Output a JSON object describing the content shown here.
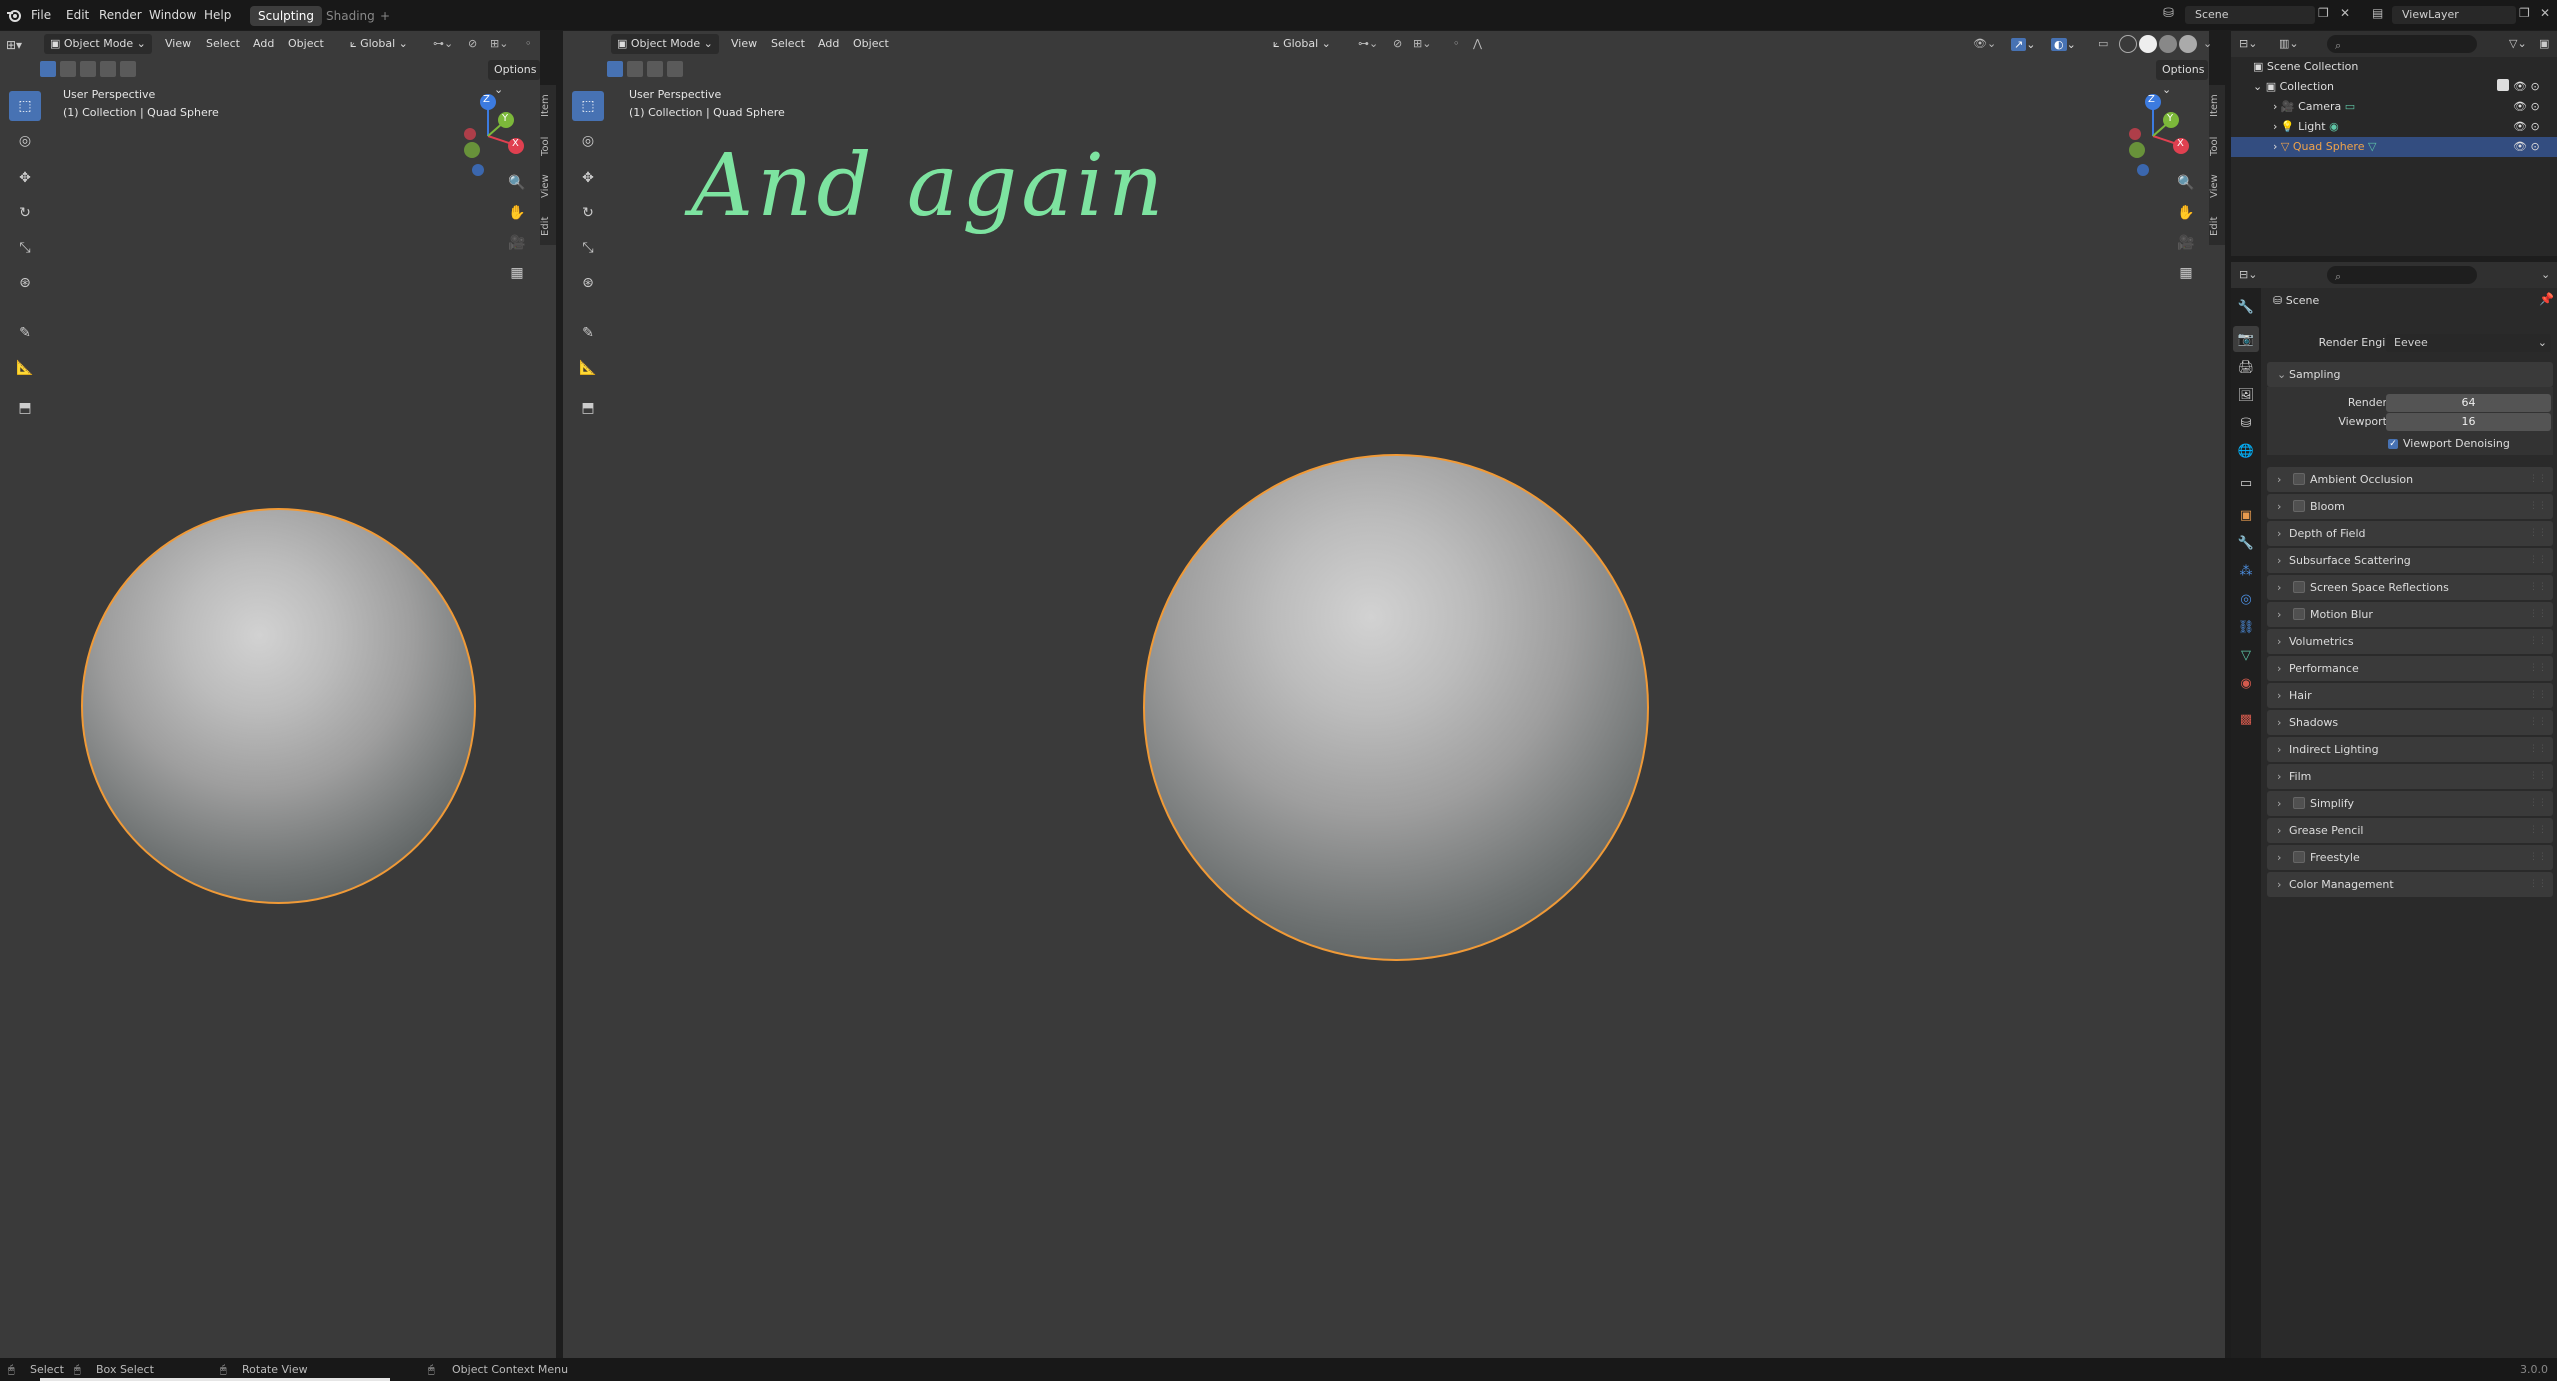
{
  "topbar": {
    "menus": [
      "File",
      "Edit",
      "Render",
      "Window",
      "Help"
    ],
    "workspaces": [
      "Sculpting",
      "Shading"
    ],
    "add_tab": "+",
    "scene_label": "Scene",
    "viewlayer_label": "ViewLayer"
  },
  "left_viewport": {
    "mode": "Object Mode",
    "menus": [
      "View",
      "Select",
      "Add",
      "Object"
    ],
    "orientation": "Global",
    "options": "Options",
    "perspective": "User Perspective",
    "collection": "(1) Collection | Quad Sphere",
    "side_tabs": [
      "Item",
      "Tool",
      "View",
      "Edit"
    ]
  },
  "right_viewport": {
    "mode": "Object Mode",
    "menus": [
      "View",
      "Select",
      "Add",
      "Object"
    ],
    "orientation": "Global",
    "options": "Options",
    "perspective": "User Perspective",
    "collection": "(1) Collection | Quad Sphere",
    "annotation": "And again",
    "side_tabs": [
      "Item",
      "Tool",
      "View",
      "Edit"
    ]
  },
  "gizmo": {
    "x": "X",
    "y": "Y",
    "z": "Z"
  },
  "outliner": {
    "root": "Scene Collection",
    "collection": "Collection",
    "items": [
      "Camera",
      "Light",
      "Quad Sphere"
    ]
  },
  "properties": {
    "context": "Scene",
    "render_engine_label": "Render Engine",
    "render_engine_value": "Eevee",
    "sampling": "Sampling",
    "render_label": "Render",
    "render_value": "64",
    "viewport_label": "Viewport",
    "viewport_value": "16",
    "viewport_denoising": "Viewport Denoising",
    "sections": [
      {
        "label": "Ambient Occlusion",
        "checkbox": true
      },
      {
        "label": "Bloom",
        "checkbox": true
      },
      {
        "label": "Depth of Field",
        "checkbox": false
      },
      {
        "label": "Subsurface Scattering",
        "checkbox": false
      },
      {
        "label": "Screen Space Reflections",
        "checkbox": true
      },
      {
        "label": "Motion Blur",
        "checkbox": true
      },
      {
        "label": "Volumetrics",
        "checkbox": false
      },
      {
        "label": "Performance",
        "checkbox": false
      },
      {
        "label": "Hair",
        "checkbox": false
      },
      {
        "label": "Shadows",
        "checkbox": false
      },
      {
        "label": "Indirect Lighting",
        "checkbox": false
      },
      {
        "label": "Film",
        "checkbox": false
      },
      {
        "label": "Simplify",
        "checkbox": true
      },
      {
        "label": "Grease Pencil",
        "checkbox": false
      },
      {
        "label": "Freestyle",
        "checkbox": true
      },
      {
        "label": "Color Management",
        "checkbox": false
      }
    ]
  },
  "statusbar": {
    "select": "Select",
    "box_select": "Box Select",
    "rotate_view": "Rotate View",
    "context_menu": "Object Context Menu",
    "version": "3.0.0"
  },
  "colors": {
    "accent": "#4772b3",
    "selection_outline": "#f09a37",
    "annotation": "#7de3a0",
    "selected_item_text": "#f0a34a"
  }
}
